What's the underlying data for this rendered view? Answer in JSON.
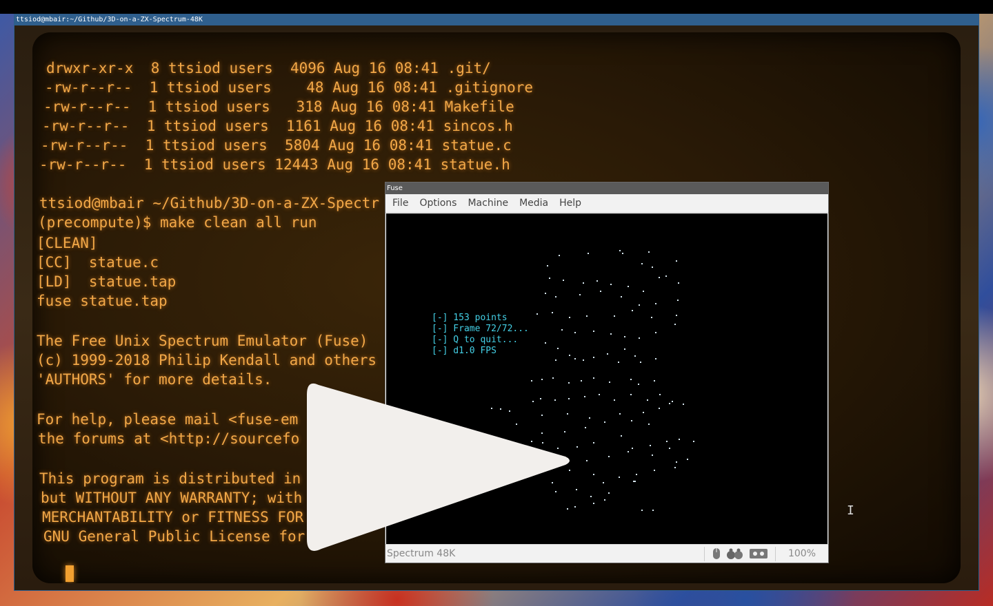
{
  "terminal": {
    "title": "ttsiod@mbair:~/Github/3D-on-a-ZX-Spectrum-48K",
    "lines": [
      "drwxr-xr-x  8 ttsiod users  4096 Aug 16 08:41 .git/",
      "-rw-r--r--  1 ttsiod users    48 Aug 16 08:41 .gitignore",
      "-rw-r--r--  1 ttsiod users   318 Aug 16 08:41 Makefile",
      "-rw-r--r--  1 ttsiod users  1161 Aug 16 08:41 sincos.h",
      "-rw-r--r--  1 ttsiod users  5804 Aug 16 08:41 statue.c",
      "-rw-r--r--  1 ttsiod users 12443 Aug 16 08:41 statue.h",
      "ttsiod@mbair ~/Github/3D-on-a-ZX-Spectr",
      "(precompute)$ make clean all run",
      "[CLEAN]",
      "[CC]  statue.c",
      "[LD]  statue.tap",
      "fuse statue.tap",
      "The Free Unix Spectrum Emulator (Fuse)",
      "(c) 1999-2018 Philip Kendall and others",
      "'AUTHORS' for more details.",
      "For help, please mail <fuse-em",
      "the forums at <http://sourcefo",
      "This program is distributed in",
      "but WITHOUT ANY WARRANTY; with",
      "MERCHANTABILITY or FITNESS FOR",
      "GNU General Public License for"
    ],
    "prompt_prefix": "(precompute)",
    "prompt_cmd": "$ make clean all run"
  },
  "fuse": {
    "title": "Fuse",
    "menu": [
      "File",
      "Options",
      "Machine",
      "Media",
      "Help"
    ],
    "screen_text": [
      "[-] 153 points",
      "[-] Frame 72/72...",
      "[-] Q to quit...",
      "[-] d1.0 FPS"
    ],
    "status_machine": "Spectrum 48K",
    "status_zoom": "100%",
    "status_icons": [
      "mouse-icon",
      "joystick-icon",
      "tape-icon"
    ]
  },
  "overlay": {
    "icon": "play-icon",
    "color": "#f2efec"
  },
  "colors": {
    "terminal_text": "#f2a848",
    "spectrum_text": "#44d0e6",
    "titlebar": "#2f5f8d"
  }
}
